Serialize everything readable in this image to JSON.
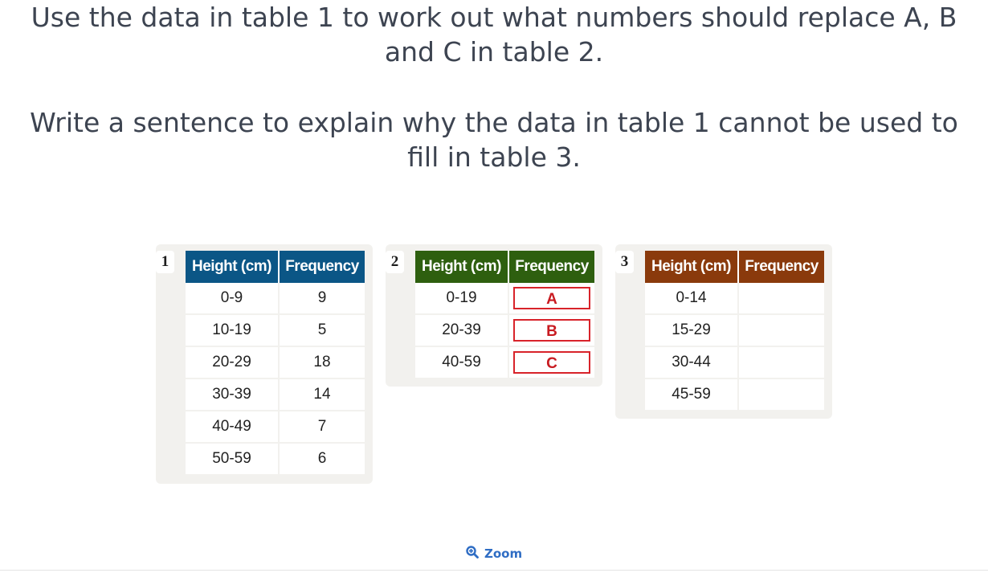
{
  "question": {
    "line1": "Use the data in table 1 to work out what numbers should replace A, B and C in table 2.",
    "line2": "Write a sentence to explain why the data in table 1 cannot be used to fill in table 3."
  },
  "tables": [
    {
      "number": "1",
      "header_color": "#0b5686",
      "headers": [
        "Height (cm)",
        "Frequency"
      ],
      "rows": [
        [
          "0-9",
          "9"
        ],
        [
          "10-19",
          "5"
        ],
        [
          "20-29",
          "18"
        ],
        [
          "30-39",
          "14"
        ],
        [
          "40-49",
          "7"
        ],
        [
          "50-59",
          "6"
        ]
      ]
    },
    {
      "number": "2",
      "header_color": "#2e5f0f",
      "headers": [
        "Height (cm)",
        "Frequency"
      ],
      "rows": [
        [
          "0-19",
          "A"
        ],
        [
          "20-39",
          "B"
        ],
        [
          "40-59",
          "C"
        ]
      ]
    },
    {
      "number": "3",
      "header_color": "#8a3a0c",
      "headers": [
        "Height (cm)",
        "Frequency"
      ],
      "rows": [
        [
          "0-14",
          ""
        ],
        [
          "15-29",
          ""
        ],
        [
          "30-44",
          ""
        ],
        [
          "45-59",
          ""
        ]
      ]
    }
  ],
  "zoom": {
    "label": "Zoom",
    "icon": "zoom-in-icon"
  }
}
